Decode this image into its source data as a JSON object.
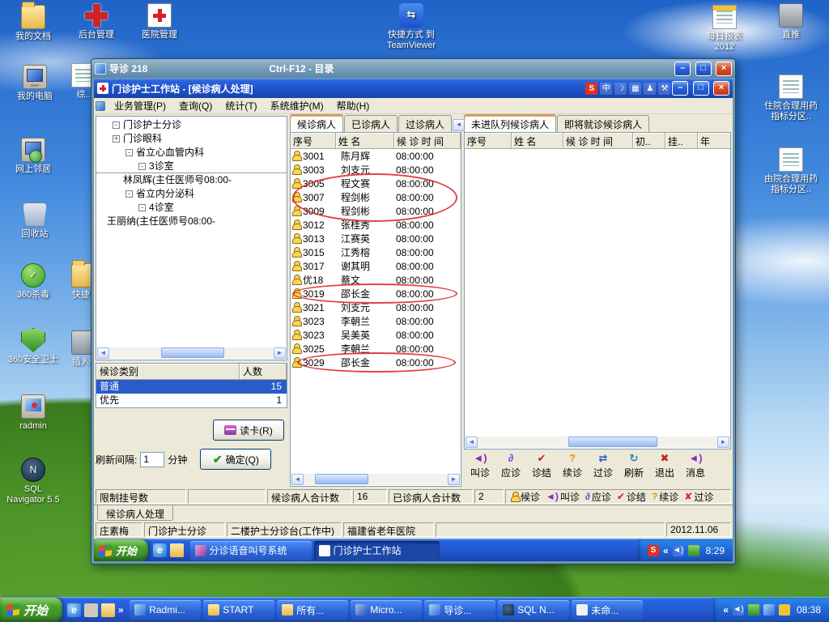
{
  "desktop": {
    "icons": {
      "my_documents": {
        "label": "我的文档"
      },
      "backend": {
        "label": "后台管理"
      },
      "hospital": {
        "label": "医院管理"
      },
      "teamviewer": {
        "label": "快捷方式 到 TeamViewer"
      },
      "daily_report": {
        "label": "每日报表2012"
      },
      "zhitui": {
        "label": "直推"
      },
      "my_computer": {
        "label": "我的电脑"
      },
      "network_places": {
        "label": "网上邻居"
      },
      "recycle_bin": {
        "label": "回收站"
      },
      "av360": {
        "label": "360杀毒"
      },
      "guard360": {
        "label": "360安全卫士"
      },
      "radmin": {
        "label": "radmin"
      },
      "sql_navigator": {
        "label": "SQL Navigator 5.5"
      },
      "inpatient_report1": {
        "label": "住院合理用药指标分区.."
      },
      "inpatient_report2": {
        "label": "由院合理用药指标分区.."
      },
      "partial_zong": {
        "label": "综.."
      },
      "partial_kuaijie": {
        "label": "快捷.."
      },
      "partial_charu": {
        "label": "插入.."
      }
    }
  },
  "radmin_window": {
    "title": "导诊 218",
    "hint": "Ctrl-F12 - 目录"
  },
  "app": {
    "title": "门诊护士工作站 - [候诊病人处理]",
    "langbar": {
      "ime": "S",
      "lang": "中",
      "moon": "☽",
      "kbd": "▦",
      "user": "♟",
      "tool": "⚒"
    },
    "menus": [
      "业务管理(P)",
      "查询(Q)",
      "统计(T)",
      "系统维护(M)",
      "帮助(H)"
    ],
    "tree": {
      "items": [
        {
          "toggle": "-",
          "label": "门诊护士分诊"
        },
        {
          "toggle": "+",
          "label": "门诊眼科"
        },
        {
          "toggle": "-",
          "label": "省立心血管内科"
        },
        {
          "toggle": "-",
          "label": "3诊室"
        },
        {
          "toggle": "",
          "label": "林凤辉(主任医师号08:00-"
        },
        {
          "toggle": "-",
          "label": "省立内分泌科"
        },
        {
          "toggle": "-",
          "label": "4诊室"
        },
        {
          "toggle": "",
          "label": "王丽纳(主任医师号08:00-"
        }
      ]
    },
    "category_table": {
      "header_type": "候诊类别",
      "header_count": "人数",
      "rows": [
        {
          "type": "普通",
          "count": "15"
        },
        {
          "type": "优先",
          "count": "1"
        }
      ]
    },
    "buttons": {
      "read_card": "读卡(R)",
      "confirm": "确定(Q)"
    },
    "interval": {
      "label": "刷新间隔:",
      "value": "1",
      "unit": "分钟"
    },
    "patient_tabs": [
      "候诊病人",
      "已诊病人",
      "过诊病人"
    ],
    "patient_grid": {
      "headers": [
        "序号",
        "姓  名",
        "候 诊 时 间"
      ],
      "rows": [
        {
          "no": "3001",
          "name": "陈月辉",
          "time": "08:00:00"
        },
        {
          "no": "3003",
          "name": "刘支元",
          "time": "08:00:00"
        },
        {
          "no": "3005",
          "name": "程文赛",
          "time": "08:00:00"
        },
        {
          "no": "3007",
          "name": "程剑彬",
          "time": "08:00:00"
        },
        {
          "no": "3009",
          "name": "程剑彬",
          "time": "08:00:00"
        },
        {
          "no": "3012",
          "name": "张桂秀",
          "time": "08:00:00"
        },
        {
          "no": "3013",
          "name": "江赛英",
          "time": "08:00:00"
        },
        {
          "no": "3015",
          "name": "江秀榕",
          "time": "08:00:00"
        },
        {
          "no": "3017",
          "name": "谢其明",
          "time": "08:00:00"
        },
        {
          "no": "优18",
          "name": "蔡文",
          "time": "08:00:00"
        },
        {
          "no": "3019",
          "name": "邵长金",
          "time": "08:00:00"
        },
        {
          "no": "3021",
          "name": "刘支元",
          "time": "08:00:00"
        },
        {
          "no": "3023",
          "name": "李朝兰",
          "time": "08:00:00"
        },
        {
          "no": "3023",
          "name": "吴美英",
          "time": "08:00:00"
        },
        {
          "no": "3025",
          "name": "李朝兰",
          "time": "08:00:00"
        },
        {
          "no": "3029",
          "name": "邵长金",
          "time": "08:00:00"
        }
      ]
    },
    "queue_tabs": [
      "未进队列候诊病人",
      "即将就诊候诊病人"
    ],
    "queue_headers": [
      "序号",
      "姓  名",
      "候 诊 时 间",
      "初..",
      "挂..",
      "年"
    ],
    "toolbar": [
      {
        "icon": "call-icon",
        "glyph": "◄)",
        "label": "叫诊"
      },
      {
        "icon": "respond-icon",
        "glyph": "∂",
        "label": "应诊"
      },
      {
        "icon": "finish-icon",
        "glyph": "✔",
        "label": "诊结"
      },
      {
        "icon": "continue-icon",
        "glyph": "?",
        "label": "续诊"
      },
      {
        "icon": "pass-icon",
        "glyph": "⇄",
        "label": "过诊"
      },
      {
        "icon": "refresh-icon",
        "glyph": "↻",
        "label": "刷新"
      },
      {
        "icon": "exit-icon",
        "glyph": "✖",
        "label": "退出"
      },
      {
        "icon": "message-icon",
        "glyph": "◄)",
        "label": "消息"
      }
    ],
    "status1": {
      "limit": "限制挂号数",
      "waiting_label": "候诊病人合计数",
      "waiting_count": "16",
      "seen_label": "已诊病人合计数",
      "seen_count": "2",
      "legend": [
        {
          "glyph": "",
          "label": "候诊"
        },
        {
          "glyph": "◄)",
          "label": "叫诊"
        },
        {
          "glyph": "∂",
          "label": "应诊"
        },
        {
          "glyph": "✔",
          "label": "诊结"
        },
        {
          "glyph": "?",
          "label": "续诊"
        },
        {
          "glyph": "✘",
          "label": "过诊"
        }
      ]
    },
    "sheet_tab": "候诊病人处理",
    "status2": {
      "user": "庄素梅",
      "role": "门诊护士分诊",
      "station": "二楼护士分诊台(工作中)",
      "hospital": "福建省老年医院",
      "date": "2012.11.06"
    }
  },
  "remote_taskbar": {
    "start": "开始",
    "tasks": [
      "分诊语音叫号系统",
      "门诊护士工作站"
    ],
    "ime": "S",
    "time": "8:29"
  },
  "taskbar": {
    "start": "开始",
    "tasks": [
      "Radmi...",
      "START",
      "所有...",
      "Micro...",
      "导诊...",
      "SQL N...",
      "未命..."
    ],
    "time": "08:38"
  },
  "colors": {
    "taskbar_blue": "#2157d0",
    "start_green": "#4aa32e",
    "title_blue": "#1e51c8",
    "radmin_title_teal": "#6e95ab",
    "selection_blue": "#2a5cc8",
    "annotation_red": "#dd2222"
  }
}
